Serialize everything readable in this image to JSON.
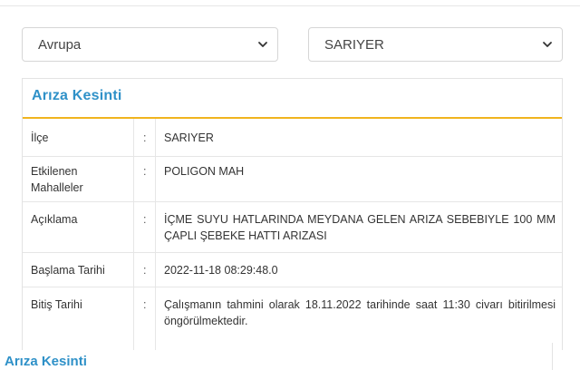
{
  "filters": {
    "region": {
      "selected": "Avrupa"
    },
    "district": {
      "selected": "SARIYER"
    }
  },
  "card": {
    "title": "Arıza Kesinti",
    "separator": ":",
    "rows": [
      {
        "label": "İlçe",
        "value": "SARIYER"
      },
      {
        "label": "Etkilenen Mahalleler",
        "value": "POLIGON MAH"
      },
      {
        "label": "Açıklama",
        "value": "İÇME SUYU HATLARINDA MEYDANA GELEN ARIZA SEBEBIYLE 100 MM ÇAPLI ŞEBEKE HATTI ARIZASI"
      },
      {
        "label": "Başlama Tarihi",
        "value": "2022-11-18 08:29:48.0"
      },
      {
        "label": "Bitiş Tarihi",
        "value": "Çalışmanın tahmini olarak 18.11.2022 tarihinde saat 11:30 civarı bitirilmesi öngörülmektedir."
      }
    ]
  },
  "next_card": {
    "title": "Arıza Kesinti"
  },
  "colors": {
    "title_blue": "#2f91c8",
    "accent_yellow": "#f0b41e",
    "border": "#e3e3e3"
  },
  "icons": {
    "select_arrow": "chevron-down-icon"
  }
}
